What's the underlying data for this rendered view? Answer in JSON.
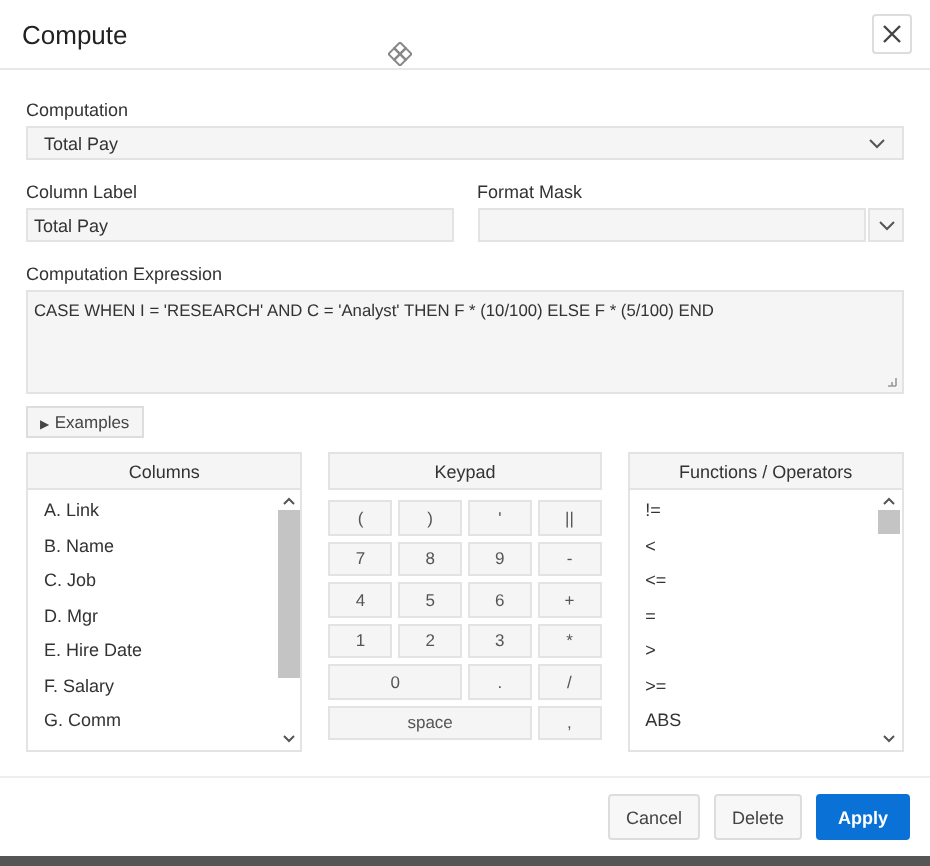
{
  "window": {
    "title": "Compute"
  },
  "computation": {
    "label": "Computation",
    "value": "Total Pay"
  },
  "column_label": {
    "label": "Column Label",
    "value": "Total Pay"
  },
  "format_mask": {
    "label": "Format Mask"
  },
  "expression": {
    "label": "Computation Expression",
    "value": "CASE WHEN  I = 'RESEARCH'  AND  C = 'Analyst' THEN  F * (10/100) ELSE  F * (5/100) END"
  },
  "examples_button": {
    "icon": "▶",
    "label": "Examples"
  },
  "columns": {
    "title": "Columns",
    "items": [
      "A. Link",
      "B. Name",
      "C. Job",
      "D. Mgr",
      "E. Hire Date",
      "F. Salary",
      "G. Comm"
    ]
  },
  "keypad": {
    "title": "Keypad",
    "keys": [
      {
        "label": "(",
        "kind": "single"
      },
      {
        "label": ")",
        "kind": "single"
      },
      {
        "label": "'",
        "kind": "single"
      },
      {
        "label": "||",
        "kind": "single"
      },
      {
        "label": "7",
        "kind": "single"
      },
      {
        "label": "8",
        "kind": "single"
      },
      {
        "label": "9",
        "kind": "single"
      },
      {
        "label": "-",
        "kind": "single"
      },
      {
        "label": "4",
        "kind": "single"
      },
      {
        "label": "5",
        "kind": "single"
      },
      {
        "label": "6",
        "kind": "single"
      },
      {
        "label": "+",
        "kind": "single"
      },
      {
        "label": "1",
        "kind": "single"
      },
      {
        "label": "2",
        "kind": "single"
      },
      {
        "label": "3",
        "kind": "single"
      },
      {
        "label": "*",
        "kind": "single"
      },
      {
        "label": "0",
        "kind": "double"
      },
      {
        "label": ".",
        "kind": "single"
      },
      {
        "label": "/",
        "kind": "single"
      },
      {
        "label": "space",
        "kind": "triple"
      },
      {
        "label": ",",
        "kind": "single"
      }
    ]
  },
  "functions": {
    "title": "Functions / Operators",
    "items": [
      "!=",
      "<",
      "<=",
      "=",
      ">",
      ">=",
      "ABS"
    ]
  },
  "buttons": [
    {
      "label": "Cancel",
      "kind": "secondary"
    },
    {
      "label": "Delete",
      "kind": "secondary"
    },
    {
      "label": "Apply",
      "kind": "primary"
    }
  ]
}
